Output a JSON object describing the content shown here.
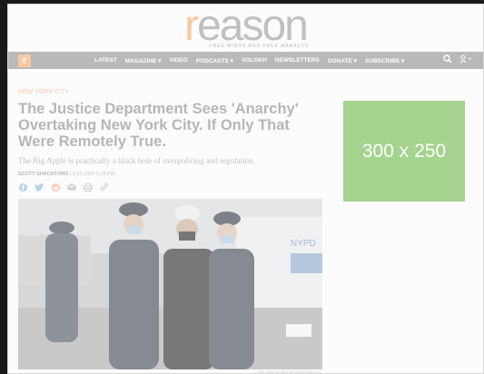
{
  "header": {
    "logo_first": "r",
    "logo_rest": "eason",
    "tagline": "FREE MINDS AND FREE MARKETS"
  },
  "nav": {
    "logo_mark": "r",
    "items": [
      "LATEST",
      "MAGAZINE ▾",
      "VIDEO",
      "PODCASTS ▾",
      "VOLOKH",
      "NEWSLETTERS",
      "DONATE ▾",
      "SUBSCRIBE ▾"
    ],
    "search_icon": "search-icon",
    "user_icon": "user-icon"
  },
  "article": {
    "kicker": "NEW YORK CITY",
    "headline": "The Justice Department Sees 'Anarchy' Overtaking New York City. If Only That Were Remotely True.",
    "subhead": "The Big Apple is practically a black hole of overpolicing and regulation.",
    "author": "SCOTT SHACKFORD",
    "date": "9.21.2020 2:20 PM",
    "share_icons": [
      "facebook-icon",
      "twitter-icon",
      "reddit-icon",
      "email-icon",
      "print-icon",
      "link-icon"
    ],
    "image_credit": "(John Marshall Mantel/Polaris/Newscom)"
  },
  "ad": {
    "label": "300 x 250"
  },
  "colors": {
    "accent": "#f2a96b",
    "nav_bg": "#8e8e8e",
    "ad_bg": "#6fb84d"
  }
}
